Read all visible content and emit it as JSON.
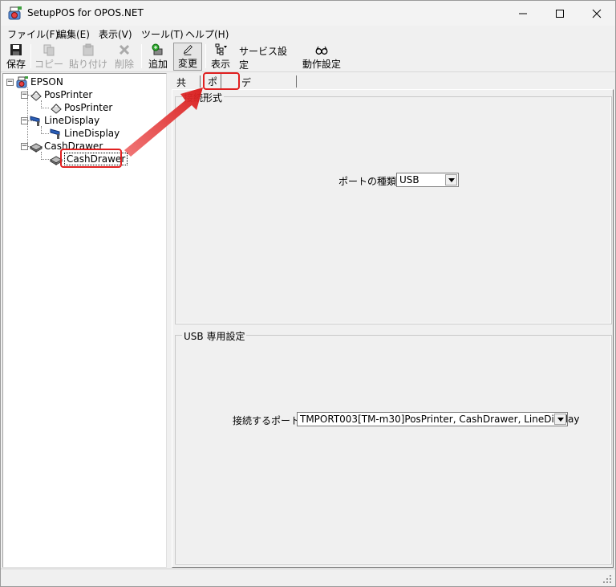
{
  "window": {
    "title": "SetupPOS for OPOS.NET",
    "minimize_icon": "minimize-icon",
    "maximize_icon": "maximize-icon",
    "close_icon": "close-icon"
  },
  "menu": {
    "items": [
      {
        "label": "ファイル(F)"
      },
      {
        "label": "編集(E)"
      },
      {
        "label": "表示(V)"
      },
      {
        "label": "ツール(T)"
      },
      {
        "label": "ヘルプ(H)"
      }
    ]
  },
  "toolbar": {
    "save": "保存",
    "copy": "コピー",
    "paste": "貼り付け",
    "delete": "削除",
    "add": "追加",
    "change": "変更",
    "view": "表示",
    "service_settings": "サービス設定",
    "operation_settings": "動作設定"
  },
  "tree": {
    "root": "EPSON",
    "nodes": [
      {
        "label": "PosPrinter",
        "child": "PosPrinter"
      },
      {
        "label": "LineDisplay",
        "child": "LineDisplay"
      },
      {
        "label": "CashDrawer",
        "child": "CashDrawer"
      }
    ]
  },
  "tabs": {
    "common": "共通",
    "port": "ポート",
    "device_settings": "デバイス設定"
  },
  "connection_group": {
    "title": "接続形式",
    "port_type_label": "ポートの種類",
    "port_type_value": "USB"
  },
  "usb_group": {
    "title": "USB 専用設定",
    "connect_port_label": "接続するポート",
    "connect_port_value": "TMPORT003[TM-m30]PosPrinter, CashDrawer, LineDisplay"
  },
  "colors": {
    "highlight": "#e02020",
    "window_bg": "#f0f0f0"
  }
}
